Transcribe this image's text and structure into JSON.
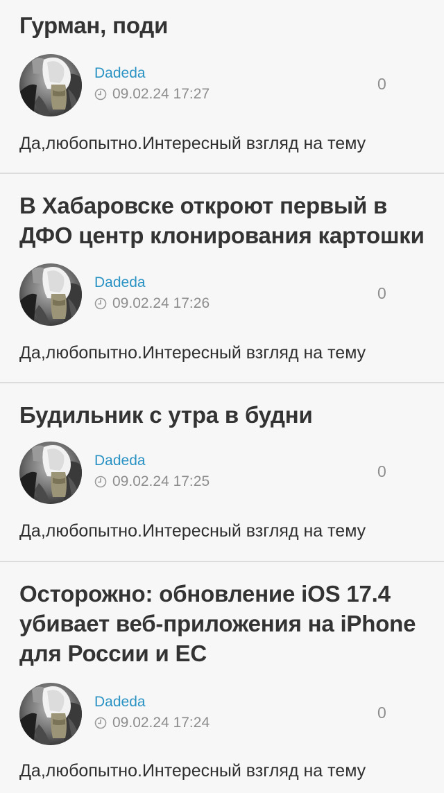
{
  "posts": [
    {
      "title": "Гурман, поди",
      "author": "Dadeda",
      "time": "09.02.24 17:27",
      "count": "0",
      "comment": "Да,любопытно.Интересный взгляд на тему"
    },
    {
      "title": "В Хабаровске откроют первый в ДФО центр клонирования картошки",
      "author": "Dadeda",
      "time": "09.02.24 17:26",
      "count": "0",
      "comment": "Да,любопытно.Интересный взгляд на тему"
    },
    {
      "title": "Будильник с утра в будни",
      "author": "Dadeda",
      "time": "09.02.24 17:25",
      "count": "0",
      "comment": "Да,любопытно.Интересный взгляд на тему"
    },
    {
      "title": "Осторожно: обновление iOS 17.4 убивает веб-приложения на iPhone для России и ЕС",
      "author": "Dadeda",
      "time": "09.02.24 17:24",
      "count": "0",
      "comment": "Да,любопытно.Интересный взгляд на тему"
    }
  ],
  "colors": {
    "background": "#f7f7f7",
    "author_link": "#2b93c4",
    "meta_text": "#8d8d8d",
    "divider": "#dcdcdc"
  },
  "icons": {
    "time": "clock-icon",
    "avatar": "user-avatar"
  }
}
